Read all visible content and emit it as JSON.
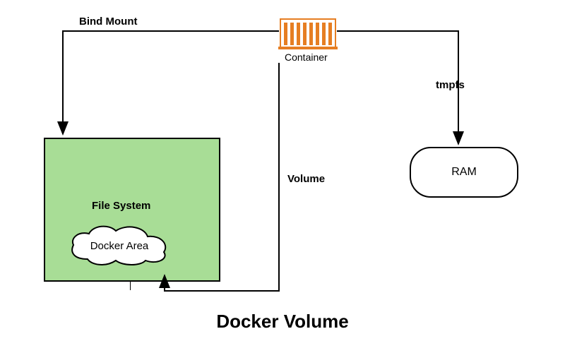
{
  "labels": {
    "bind_mount": "Bind Mount",
    "container": "Container",
    "tmpfs": "tmpfs",
    "ram": "RAM",
    "volume": "Volume",
    "file_system": "File System",
    "docker_area": "Docker Area"
  },
  "title": "Docker Volume",
  "colors": {
    "container_orange": "#e67e22",
    "filesystem_green": "#a8dd96"
  }
}
